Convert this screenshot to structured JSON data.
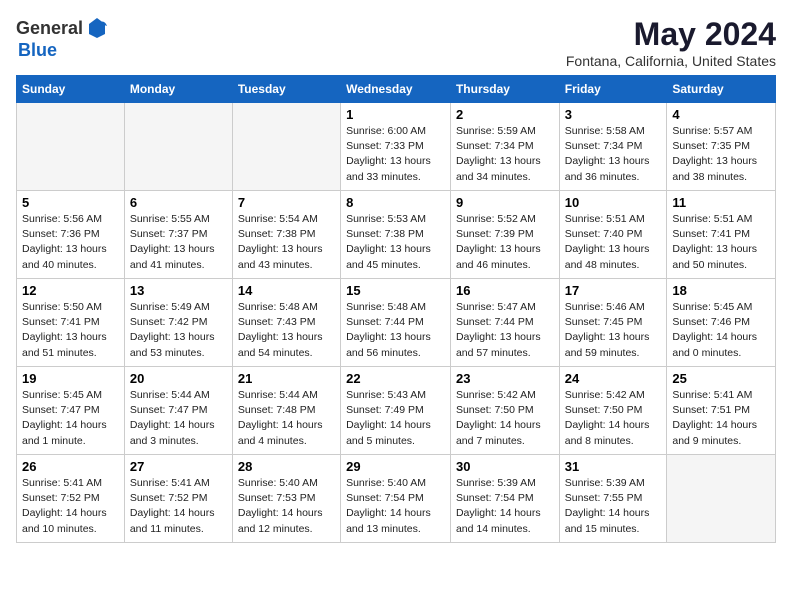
{
  "header": {
    "logo_general": "General",
    "logo_blue": "Blue",
    "month_title": "May 2024",
    "location": "Fontana, California, United States"
  },
  "days_of_week": [
    "Sunday",
    "Monday",
    "Tuesday",
    "Wednesday",
    "Thursday",
    "Friday",
    "Saturday"
  ],
  "weeks": [
    [
      {
        "day": "",
        "empty": true
      },
      {
        "day": "",
        "empty": true
      },
      {
        "day": "",
        "empty": true
      },
      {
        "day": "1",
        "sunrise": "6:00 AM",
        "sunset": "7:33 PM",
        "daylight": "13 hours and 33 minutes."
      },
      {
        "day": "2",
        "sunrise": "5:59 AM",
        "sunset": "7:34 PM",
        "daylight": "13 hours and 34 minutes."
      },
      {
        "day": "3",
        "sunrise": "5:58 AM",
        "sunset": "7:34 PM",
        "daylight": "13 hours and 36 minutes."
      },
      {
        "day": "4",
        "sunrise": "5:57 AM",
        "sunset": "7:35 PM",
        "daylight": "13 hours and 38 minutes."
      }
    ],
    [
      {
        "day": "5",
        "sunrise": "5:56 AM",
        "sunset": "7:36 PM",
        "daylight": "13 hours and 40 minutes."
      },
      {
        "day": "6",
        "sunrise": "5:55 AM",
        "sunset": "7:37 PM",
        "daylight": "13 hours and 41 minutes."
      },
      {
        "day": "7",
        "sunrise": "5:54 AM",
        "sunset": "7:38 PM",
        "daylight": "13 hours and 43 minutes."
      },
      {
        "day": "8",
        "sunrise": "5:53 AM",
        "sunset": "7:38 PM",
        "daylight": "13 hours and 45 minutes."
      },
      {
        "day": "9",
        "sunrise": "5:52 AM",
        "sunset": "7:39 PM",
        "daylight": "13 hours and 46 minutes."
      },
      {
        "day": "10",
        "sunrise": "5:51 AM",
        "sunset": "7:40 PM",
        "daylight": "13 hours and 48 minutes."
      },
      {
        "day": "11",
        "sunrise": "5:51 AM",
        "sunset": "7:41 PM",
        "daylight": "13 hours and 50 minutes."
      }
    ],
    [
      {
        "day": "12",
        "sunrise": "5:50 AM",
        "sunset": "7:41 PM",
        "daylight": "13 hours and 51 minutes."
      },
      {
        "day": "13",
        "sunrise": "5:49 AM",
        "sunset": "7:42 PM",
        "daylight": "13 hours and 53 minutes."
      },
      {
        "day": "14",
        "sunrise": "5:48 AM",
        "sunset": "7:43 PM",
        "daylight": "13 hours and 54 minutes."
      },
      {
        "day": "15",
        "sunrise": "5:48 AM",
        "sunset": "7:44 PM",
        "daylight": "13 hours and 56 minutes."
      },
      {
        "day": "16",
        "sunrise": "5:47 AM",
        "sunset": "7:44 PM",
        "daylight": "13 hours and 57 minutes."
      },
      {
        "day": "17",
        "sunrise": "5:46 AM",
        "sunset": "7:45 PM",
        "daylight": "13 hours and 59 minutes."
      },
      {
        "day": "18",
        "sunrise": "5:45 AM",
        "sunset": "7:46 PM",
        "daylight": "14 hours and 0 minutes."
      }
    ],
    [
      {
        "day": "19",
        "sunrise": "5:45 AM",
        "sunset": "7:47 PM",
        "daylight": "14 hours and 1 minute."
      },
      {
        "day": "20",
        "sunrise": "5:44 AM",
        "sunset": "7:47 PM",
        "daylight": "14 hours and 3 minutes."
      },
      {
        "day": "21",
        "sunrise": "5:44 AM",
        "sunset": "7:48 PM",
        "daylight": "14 hours and 4 minutes."
      },
      {
        "day": "22",
        "sunrise": "5:43 AM",
        "sunset": "7:49 PM",
        "daylight": "14 hours and 5 minutes."
      },
      {
        "day": "23",
        "sunrise": "5:42 AM",
        "sunset": "7:50 PM",
        "daylight": "14 hours and 7 minutes."
      },
      {
        "day": "24",
        "sunrise": "5:42 AM",
        "sunset": "7:50 PM",
        "daylight": "14 hours and 8 minutes."
      },
      {
        "day": "25",
        "sunrise": "5:41 AM",
        "sunset": "7:51 PM",
        "daylight": "14 hours and 9 minutes."
      }
    ],
    [
      {
        "day": "26",
        "sunrise": "5:41 AM",
        "sunset": "7:52 PM",
        "daylight": "14 hours and 10 minutes."
      },
      {
        "day": "27",
        "sunrise": "5:41 AM",
        "sunset": "7:52 PM",
        "daylight": "14 hours and 11 minutes."
      },
      {
        "day": "28",
        "sunrise": "5:40 AM",
        "sunset": "7:53 PM",
        "daylight": "14 hours and 12 minutes."
      },
      {
        "day": "29",
        "sunrise": "5:40 AM",
        "sunset": "7:54 PM",
        "daylight": "14 hours and 13 minutes."
      },
      {
        "day": "30",
        "sunrise": "5:39 AM",
        "sunset": "7:54 PM",
        "daylight": "14 hours and 14 minutes."
      },
      {
        "day": "31",
        "sunrise": "5:39 AM",
        "sunset": "7:55 PM",
        "daylight": "14 hours and 15 minutes."
      },
      {
        "day": "",
        "empty": true
      }
    ]
  ]
}
